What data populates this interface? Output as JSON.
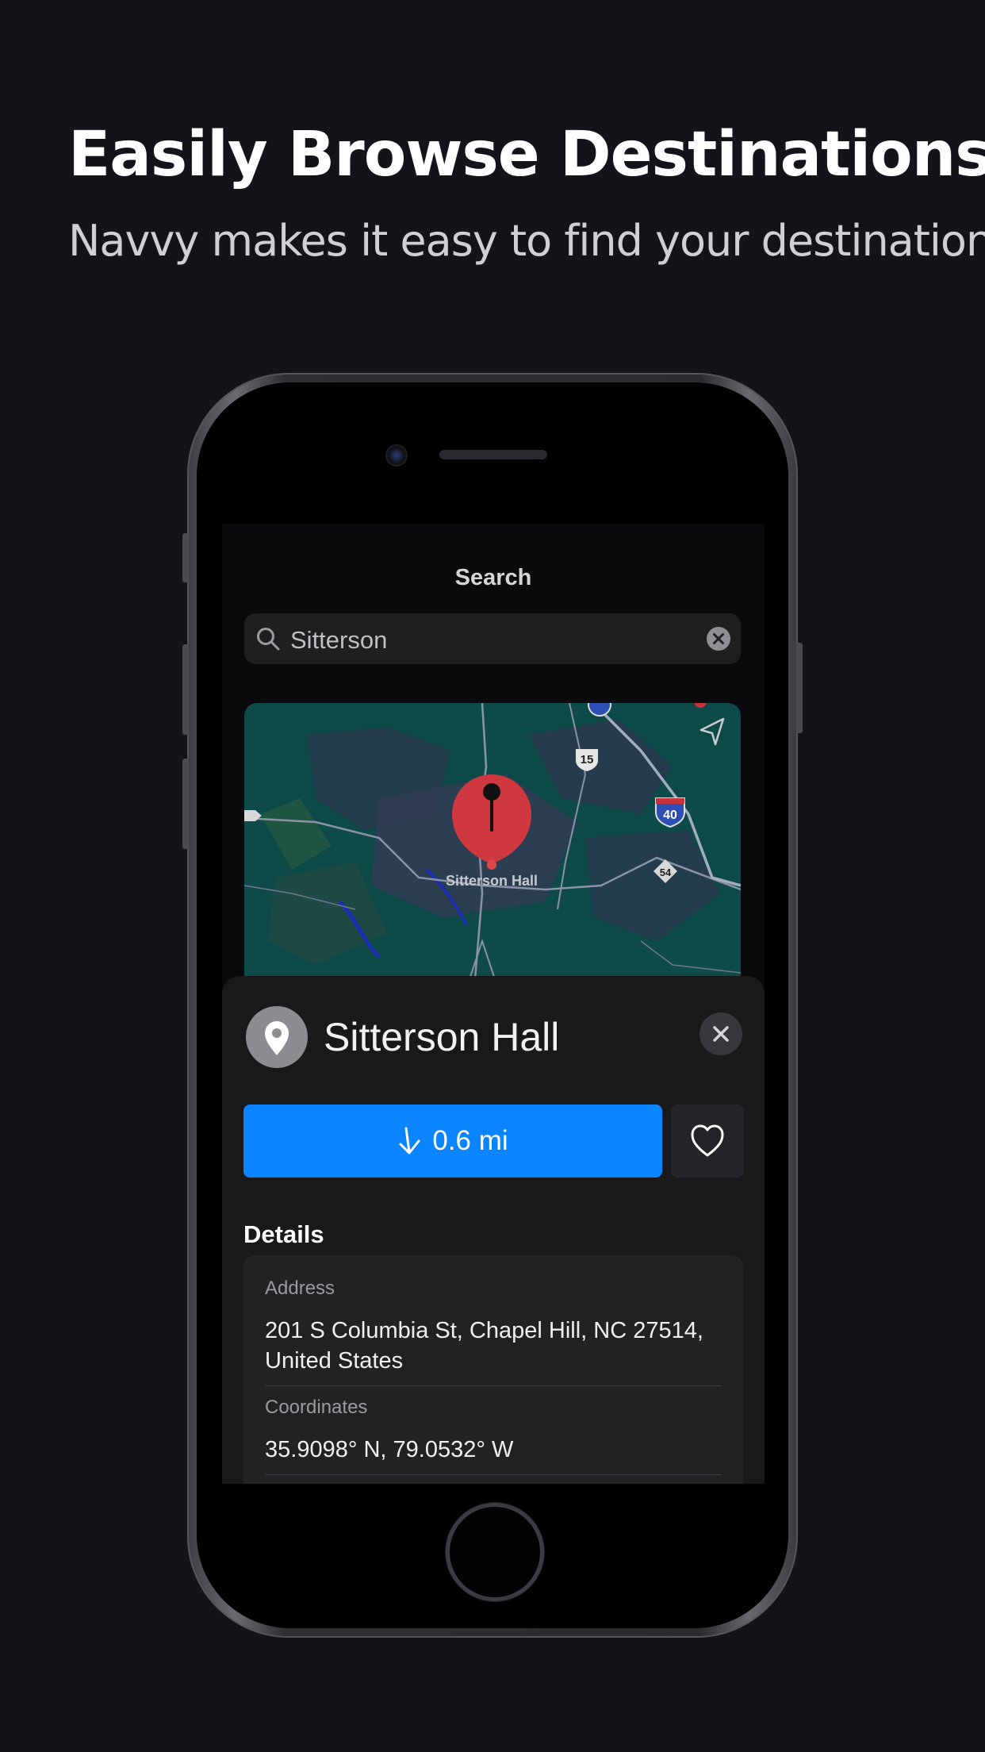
{
  "promo": {
    "headline": "Easily Browse Destinations.",
    "subheadline": "Navvy makes it easy to find your destination."
  },
  "screen": {
    "title": "Search",
    "search": {
      "value": "Sitterson",
      "icon": "search-icon",
      "clear_icon": "clear-icon"
    },
    "map": {
      "pin_label": "Sitterson Hall",
      "route_shields": [
        "15",
        "40",
        "54"
      ],
      "locate_icon": "location-arrow-icon"
    },
    "place": {
      "name": "Sitterson Hall",
      "icon": "map-pin-icon",
      "directions_label": "0.6 mi",
      "directions_icon": "arrow-down-icon",
      "favorite_icon": "heart-icon",
      "close_icon": "close-icon"
    },
    "details": {
      "heading": "Details",
      "address_label": "Address",
      "address_line1": "201 S Columbia St, Chapel Hill, NC  27514,",
      "address_line2": "United States",
      "coordinates_label": "Coordinates",
      "coordinates_value": "35.9098° N, 79.0532° W"
    }
  },
  "colors": {
    "background": "#13141a",
    "accent": "#0a84ff",
    "pin": "#d0383f",
    "map_land": "#0d4a48"
  }
}
